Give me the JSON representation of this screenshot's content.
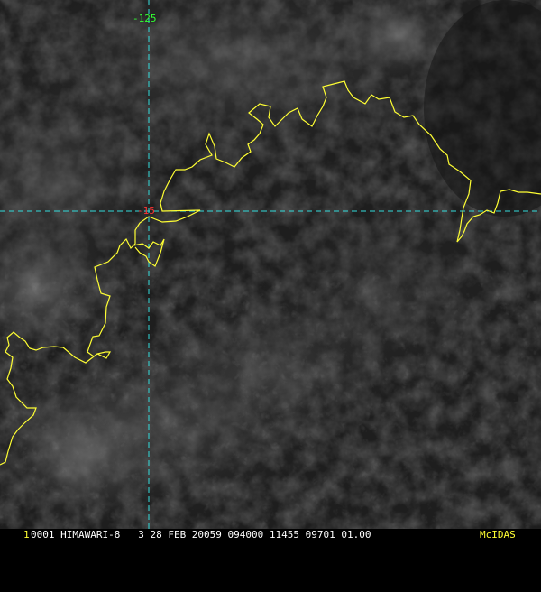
{
  "viewer": {
    "frame_number": "1",
    "status_line": "0001 HIMAWARI-8   3 28 FEB 20059 094000 11455 09701 01.00",
    "logo_text": "McIDAS",
    "colors": {
      "background": "#000000",
      "coastline": "#ffff33",
      "gridline": "#33dddd",
      "longitude_label": "#33ff33",
      "latitude_label": "#ff3333",
      "status_text": "#ffffff"
    }
  },
  "grid": {
    "longitude_label": "-125",
    "latitude_label": "-15"
  },
  "map": {
    "layer": "satellite-visible-imagery",
    "overlay": "coastline"
  }
}
